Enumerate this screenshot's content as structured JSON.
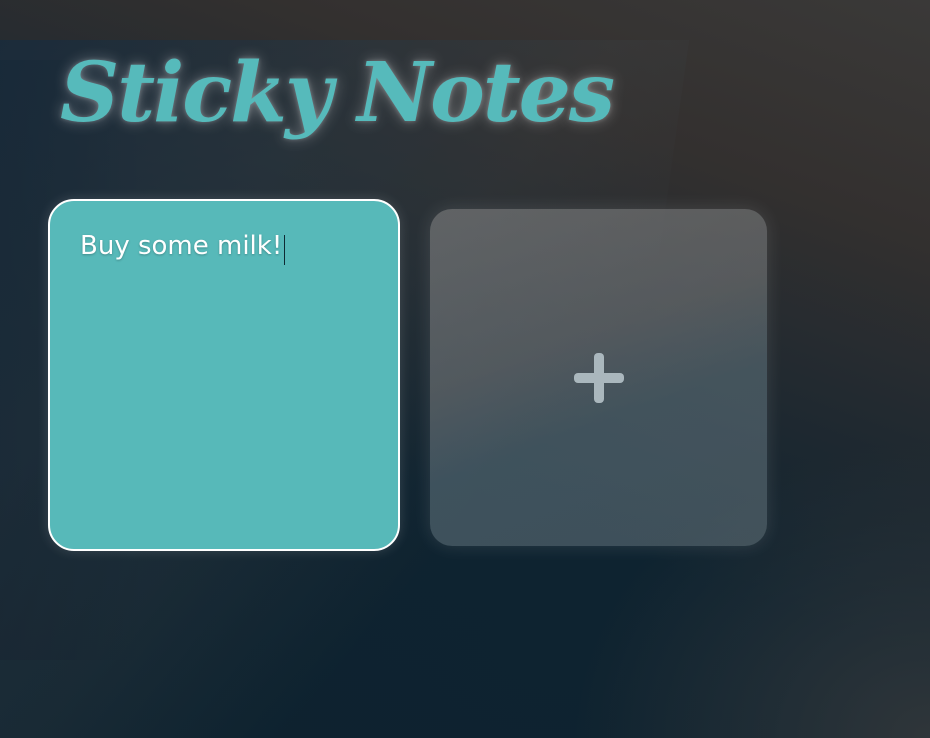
{
  "app": {
    "title": "Sticky Notes"
  },
  "notes": [
    {
      "text": "Buy some milk!",
      "color": "#57b9b9",
      "focused": true
    }
  ],
  "add_button": {
    "icon": "plus-icon"
  },
  "colors": {
    "accent": "#56babb",
    "note_border": "#ffffff"
  }
}
